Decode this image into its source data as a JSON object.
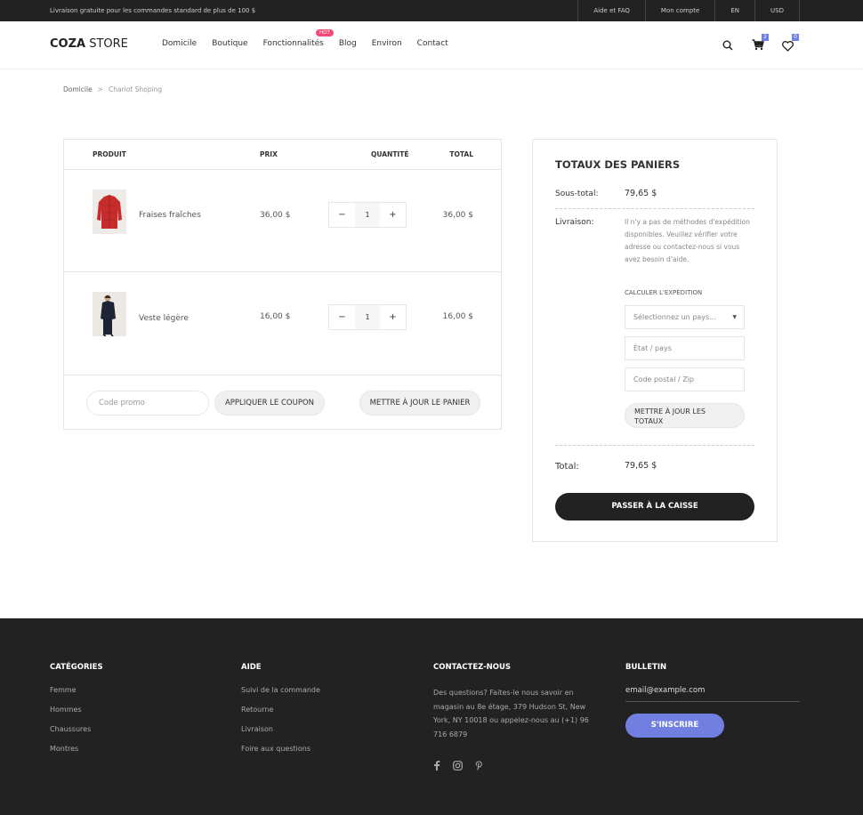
{
  "topbar": {
    "promo": "Livraison gratuite pour les commandes standard de plus de 100 $",
    "links": [
      "Aide et FAQ",
      "Mon compte",
      "EN",
      "USD"
    ]
  },
  "header": {
    "logo_bold": "COZA",
    "logo_rest": " STORE",
    "nav": [
      "Domicile",
      "Boutique",
      "Fonctionnalités",
      "Blog",
      "Environ",
      "Contact"
    ],
    "hot_badge": "HOT",
    "cart_count": "2",
    "wishlist_count": "0",
    "icons": [
      "search-icon",
      "cart-icon",
      "heart-icon"
    ]
  },
  "breadcrumb": {
    "home": "Domicile",
    "separator": ">",
    "current": "Chariot Shoping"
  },
  "cart": {
    "headers": {
      "product": "PRODUIT",
      "price": "PRIX",
      "quantity": "QUANTITÉ",
      "total": "TOTAL"
    },
    "items": [
      {
        "name": "Fraises fraîches",
        "price": "36,00 $",
        "qty": "1",
        "total": "36,00 $"
      },
      {
        "name": "Veste légère",
        "price": "16,00 $",
        "qty": "1",
        "total": "16,00 $"
      }
    ],
    "qty_minus": "−",
    "qty_plus": "+",
    "coupon_placeholder": "Code promo",
    "apply_coupon": "APPLIQUER LE COUPON",
    "update_cart": "METTRE À JOUR LE PANIER"
  },
  "totals": {
    "title": "TOTAUX DES PANIERS",
    "subtotal_label": "Sous-total:",
    "subtotal_value": "79,65 $",
    "shipping_label": "Livraison:",
    "shipping_note": "Il n'y a pas de méthodes d'expédition disponibles. Veuillez vérifier votre adresse ou contactez-nous si vous avez besoin d'aide.",
    "calc_label": "CALCULER L'EXPÉDITION",
    "country_select": "Sélectionnez un pays...",
    "state_placeholder": "État / pays",
    "zip_placeholder": "Code postal / Zip",
    "update_totals": "METTRE À JOUR LES TOTAUX",
    "total_label": "Total:",
    "total_value": "79,65 $",
    "checkout": "PASSER À LA CAISSE"
  },
  "footer": {
    "categories": {
      "title": "CATÉGORIES",
      "links": [
        "Femme",
        "Hommes",
        "Chaussures",
        "Montres"
      ]
    },
    "help": {
      "title": "AIDE",
      "links": [
        "Suivi de la commande",
        "Retourne",
        "Livraison",
        "Foire aux questions"
      ]
    },
    "contact": {
      "title": "CONTACTEZ-NOUS",
      "text": "Des questions? Faites-le nous savoir en magasin au 8e étage, 379 Hudson St, New York, NY 10018 ou appelez-nous au (+1) 96 716 6879",
      "social_icons": [
        "facebook-icon",
        "instagram-icon",
        "pinterest-icon"
      ]
    },
    "newsletter": {
      "title": "BULLETIN",
      "email_placeholder": "email@example.com",
      "subscribe": "S'INSCRIRE"
    }
  },
  "colors": {
    "dark": "#222222",
    "accent": "#717fe0",
    "hot": "#f74877"
  }
}
